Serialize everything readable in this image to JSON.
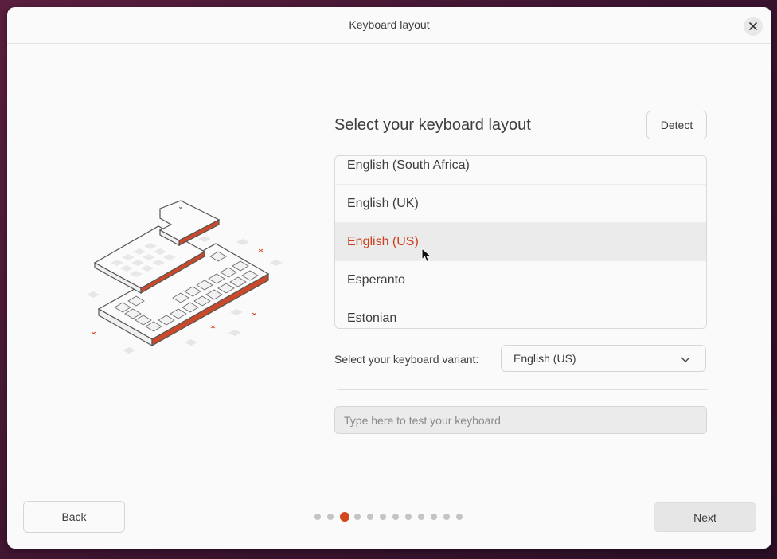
{
  "window": {
    "title": "Keyboard layout"
  },
  "main": {
    "heading": "Select your keyboard layout",
    "detect_label": "Detect",
    "layouts": [
      {
        "label": "English (South Africa)",
        "selected": false
      },
      {
        "label": "English (UK)",
        "selected": false
      },
      {
        "label": "English (US)",
        "selected": true
      },
      {
        "label": "Esperanto",
        "selected": false
      },
      {
        "label": "Estonian",
        "selected": false
      }
    ],
    "variant_label": "Select your keyboard variant:",
    "variant_value": "English (US)",
    "test_placeholder": "Type here to test your keyboard"
  },
  "footer": {
    "back_label": "Back",
    "next_label": "Next",
    "steps_total": 12,
    "current_step": 3
  },
  "colors": {
    "accent": "#d4461e",
    "selected_text": "#c7411e",
    "background": "#fafafa"
  },
  "icons": [
    "close-icon",
    "chevron-down-icon",
    "mouse-pointer-icon",
    "keyboard-illustration"
  ]
}
